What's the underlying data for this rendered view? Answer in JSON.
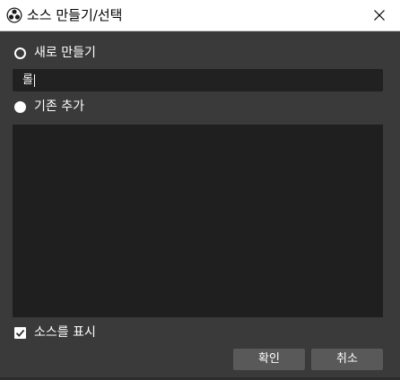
{
  "window": {
    "title": "소스 만들기/선택",
    "icon": "obs-logo-icon",
    "close_icon": "close-icon"
  },
  "create_new": {
    "label": "새로 만들기",
    "selected": false,
    "name_value": "롤"
  },
  "add_existing": {
    "label": "기존 추가",
    "selected": true,
    "items": []
  },
  "make_visible": {
    "label": "소스를 표시",
    "checked": true
  },
  "buttons": {
    "ok_label": "확인",
    "cancel_label": "취소"
  },
  "colors": {
    "background": "#3a3a3a",
    "titlebar": "#ffffff",
    "input_bg": "#212121",
    "list_bg": "#1f1f1f",
    "button_bg": "#595959",
    "text": "#ffffff"
  }
}
